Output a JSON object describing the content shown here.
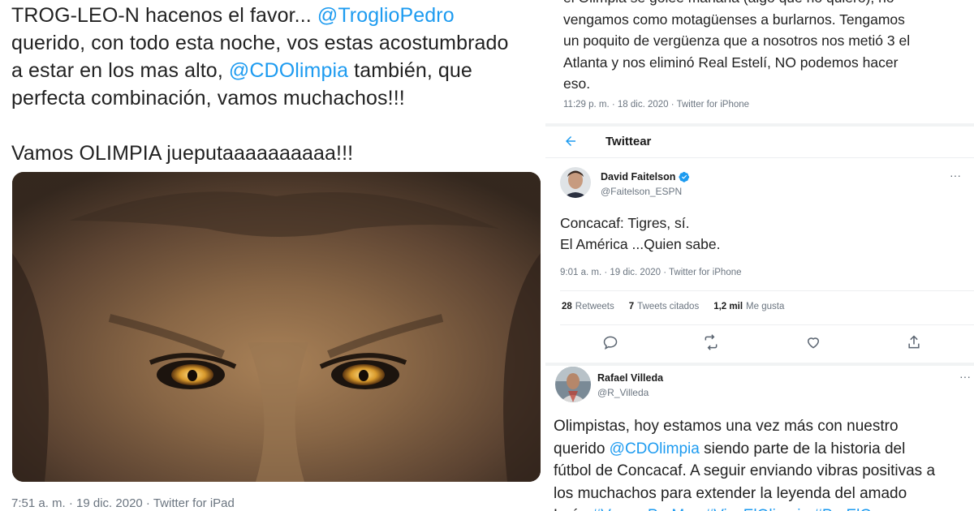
{
  "left_tweet": {
    "text_lines": [
      {
        "parts": [
          {
            "t": "TROG-LEO-N hacenos el favor... ",
            "link": false
          },
          {
            "t": "@TroglioPedro",
            "link": true
          }
        ]
      },
      {
        "parts": [
          {
            "t": "querido, con todo esta noche, vos estas acostumbrado",
            "link": false
          }
        ]
      },
      {
        "parts": [
          {
            "t": "a estar en los mas alto, ",
            "link": false
          },
          {
            "t": "@CDOlimpia",
            "link": true
          },
          {
            "t": " también, que",
            "link": false
          }
        ]
      },
      {
        "parts": [
          {
            "t": "perfecta combinación, vamos muchachos!!!",
            "link": false
          }
        ]
      }
    ],
    "text_line_2": "Vamos OLIMPIA jueputaaaaaaaaaa!!!",
    "image_icon": "lion-photo",
    "meta": "7:51 a. m. · 19 dic. 2020 · Twitter for iPad"
  },
  "top_tweet": {
    "lines": [
      "el Olimpia se golee mañana (algo que no quiero), no",
      "vengamos como motagüenses a burlarnos. Tengamos",
      "un poquito de vergüenza que a nosotros nos metió 3 el",
      "Atlanta y nos eliminó Real Estelí, NO podemos hacer",
      "eso."
    ],
    "meta": "11:29 p. m. · 18 dic. 2020 · Twitter for iPhone"
  },
  "header": {
    "back_icon": "arrow-left-icon",
    "title": "Twittear"
  },
  "faitelson": {
    "name": "David Faitelson",
    "handle": "@Faitelson_ESPN",
    "verified_icon": "verified-badge-icon",
    "more": "···",
    "lines": [
      "Concacaf: Tigres, sí.",
      "El América ...Quien sabe."
    ],
    "meta": "9:01 a. m. · 19 dic. 2020 · Twitter for iPhone",
    "stats": [
      {
        "count": "28",
        "label": "Retweets"
      },
      {
        "count": "7",
        "label": "Tweets citados"
      },
      {
        "count": "1,2 mil",
        "label": "Me gusta"
      }
    ],
    "actions": [
      "reply-icon",
      "retweet-icon",
      "like-icon",
      "share-icon"
    ]
  },
  "villeda": {
    "name": "Rafael Villeda",
    "handle": "@R_Villeda",
    "more": "···",
    "text_lines": [
      {
        "parts": [
          {
            "t": "Olimpistas, hoy estamos una vez más con nuestro",
            "link": false
          }
        ]
      },
      {
        "parts": [
          {
            "t": "querido ",
            "link": false
          },
          {
            "t": "@CDOlimpia",
            "link": true
          },
          {
            "t": " siendo parte de la historia del",
            "link": false
          }
        ]
      },
      {
        "parts": [
          {
            "t": "fútbol de Concacaf. A seguir enviando vibras positivas a",
            "link": false
          }
        ]
      },
      {
        "parts": [
          {
            "t": "los muchachos para extender la leyenda del amado",
            "link": false
          }
        ]
      },
      {
        "parts": [
          {
            "t": "León ",
            "link": false
          },
          {
            "t": "#VamosPorMas #VivaElOlimpia #PorElGrupo",
            "link": true
          }
        ]
      }
    ]
  },
  "colors": {
    "link": "#1d9bf0",
    "text": "#222222",
    "meta": "#6b7580",
    "verified": "#1d9bf0"
  }
}
